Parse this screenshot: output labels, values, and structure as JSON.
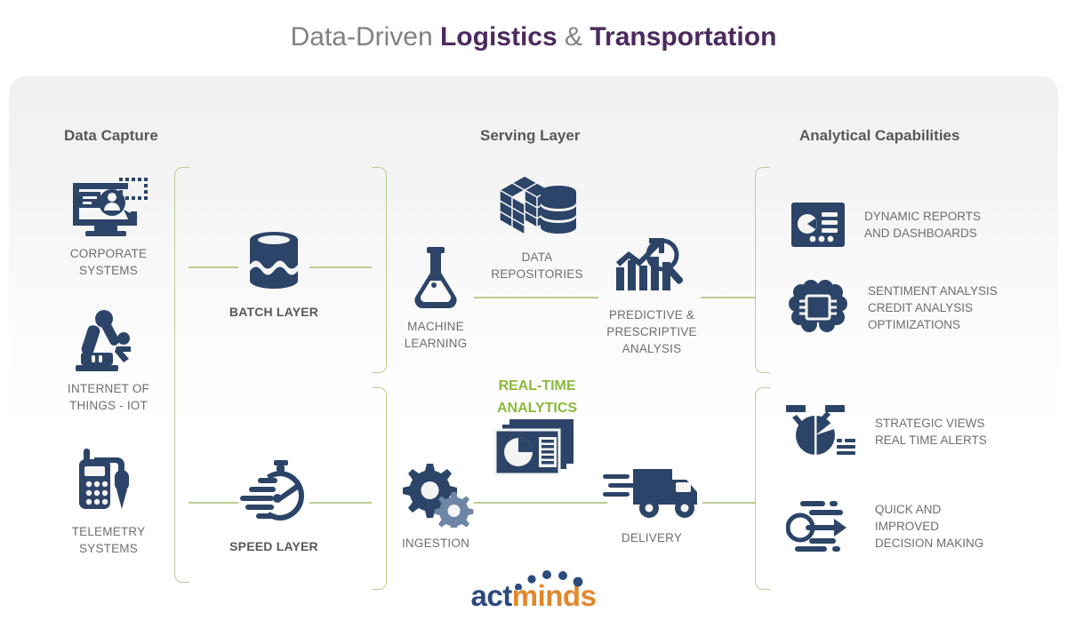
{
  "title": {
    "part1": "Data-Driven ",
    "part2": "Logistics",
    "part3": " & ",
    "part4": "Transportation",
    "accent_color": "#4b2a5e",
    "plain_color": "#808285"
  },
  "colors": {
    "icon_navy": "#2c4468",
    "icon_navy_light": "#6f85a6",
    "connector_green": "#b9ce92",
    "highlight_green": "#8cb93b",
    "panel_top": "#f0f0f0",
    "panel_bottom": "#ffffff",
    "caption_gray": "#6d6e71",
    "heading_gray": "#58585b"
  },
  "columns": [
    {
      "id": "data-capture",
      "label": "Data Capture"
    },
    {
      "id": "serving-layer",
      "label": "Serving Layer"
    },
    {
      "id": "analytical-capabilities",
      "label": "Analytical Capabilities"
    }
  ],
  "data_capture": [
    {
      "icon": "corporate-systems-icon",
      "label": "CORPORATE\nSYSTEMS"
    },
    {
      "icon": "robot-arm-icon",
      "label": "INTERNET OF\nTHINGS - IOT"
    },
    {
      "icon": "telemetry-device-icon",
      "label": "TELEMETRY\nSYSTEMS"
    }
  ],
  "layers": [
    {
      "icon": "database-batch-icon",
      "label": "BATCH LAYER"
    },
    {
      "icon": "speedometer-icon",
      "label": "SPEED LAYER"
    }
  ],
  "processing": [
    {
      "icon": "flask-icon",
      "label": "MACHINE\nLEARNING"
    },
    {
      "icon": "gears-icon",
      "label": "INGESTION"
    }
  ],
  "serving": [
    {
      "icon": "data-repositories-icon",
      "label": "DATA\nREPOSITORIES"
    },
    {
      "icon": "predictive-analysis-icon",
      "label": "PREDICTIVE &\nPRESCRIPTIVE\nANALYSIS"
    },
    {
      "icon": "delivery-truck-icon",
      "label": "DELIVERY"
    }
  ],
  "realtime": {
    "label": "REAL-TIME\nANALYTICS",
    "icon": "dashboard-report-icon"
  },
  "capabilities": [
    {
      "icon": "dashboard-reports-icon",
      "label": "DYNAMIC REPORTS\nAND DASHBOARDS"
    },
    {
      "icon": "brain-chip-icon",
      "label": "SENTIMENT ANALYSIS\nCREDIT ANALYSIS\nOPTIMIZATIONS"
    },
    {
      "icon": "pie-chart-views-icon",
      "label": "STRATEGIC VIEWS\nREAL TIME ALERTS"
    },
    {
      "icon": "fast-decision-icon",
      "label": "QUICK AND\nIMPROVED\nDECISION MAKING"
    }
  ],
  "logo": {
    "part1": "act",
    "part2": "minds",
    "dots_icon": "logo-dot-arc-icon"
  }
}
